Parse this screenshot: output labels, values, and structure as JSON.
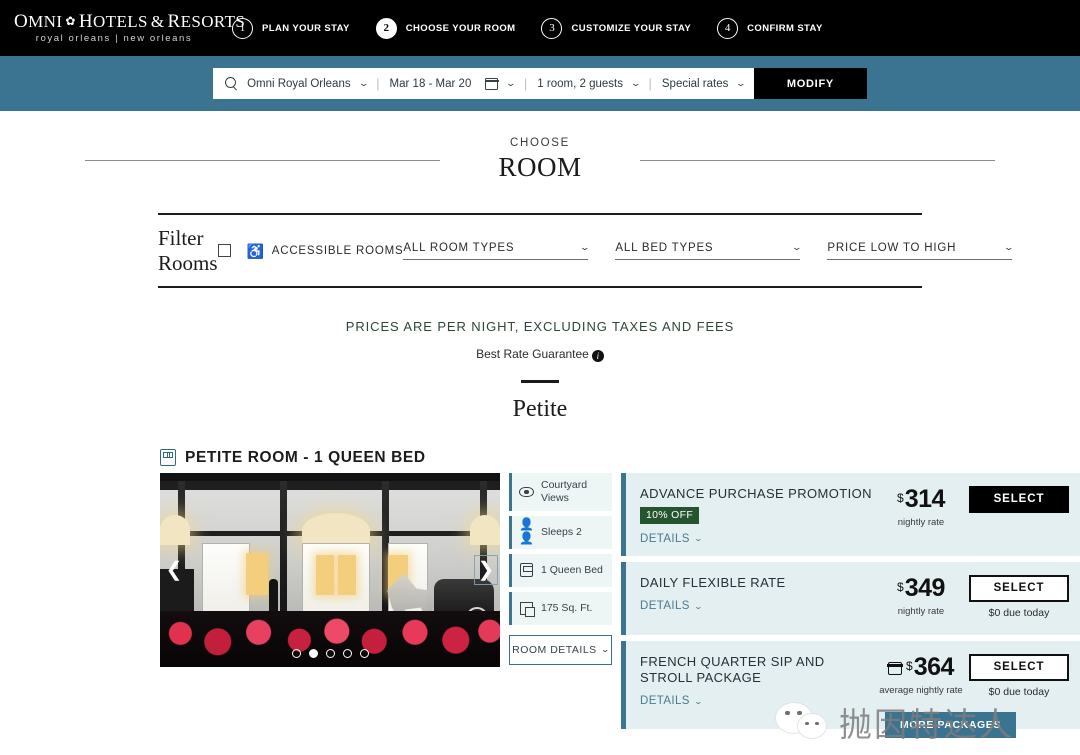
{
  "topnav": {
    "brand": {
      "line1_a": "O",
      "line1_b": "MNI",
      "line1_c": "H",
      "line1_d": "OTELS",
      "line1_e": "&",
      "line1_f": "R",
      "line1_g": "ESORTS",
      "flower": "✿",
      "sub": "royal orleans  |  new orleans"
    },
    "steps": [
      {
        "num": "1",
        "label": "PLAN YOUR STAY",
        "active": false
      },
      {
        "num": "2",
        "label": "CHOOSE YOUR ROOM",
        "active": true
      },
      {
        "num": "3",
        "label": "CUSTOMIZE YOUR STAY",
        "active": false
      },
      {
        "num": "4",
        "label": "CONFIRM STAY",
        "active": false
      }
    ]
  },
  "bookbar": {
    "property": "Omni Royal Orleans",
    "dates": "Mar 18 - Mar 20",
    "occupancy": "1 room, 2 guests",
    "rates": "Special rates",
    "modify_label": "MODIFY",
    "caret": "⌄",
    "separator": "|"
  },
  "page_head": {
    "kicker": "CHOOSE",
    "title": "ROOM"
  },
  "filter": {
    "title": "Filter Rooms",
    "accessible_label": "ACCESSIBLE ROOMS",
    "accessible_icon": "♿",
    "selects": [
      {
        "label": "ALL ROOM TYPES",
        "caret": "⌄"
      },
      {
        "label": "ALL BED TYPES",
        "caret": "⌄"
      },
      {
        "label": "PRICE LOW TO HIGH",
        "caret": "⌄"
      }
    ]
  },
  "notice": {
    "main": "PRICES ARE PER NIGHT, EXCLUDING TAXES AND FEES",
    "sub": "Best Rate Guarantee",
    "info_glyph": "i"
  },
  "category": {
    "title": "Petite"
  },
  "room": {
    "name": "PETITE ROOM - 1 QUEEN BED",
    "carousel": {
      "prev": "❮",
      "next": "❯",
      "dot_count": 5,
      "active_dot": 1
    },
    "amenities": [
      {
        "label": "Courtyard Views",
        "icon": "eye-icon"
      },
      {
        "label": "Sleeps 2",
        "icon": "people-icon",
        "glyph": "👤👤"
      },
      {
        "label": "1 Queen Bed",
        "icon": "bed-icon"
      },
      {
        "label": "175 Sq. Ft.",
        "icon": "square-feet-icon"
      }
    ],
    "room_details_label": "ROOM DETAILS",
    "room_details_caret": "⌄"
  },
  "rates": [
    {
      "name": "ADVANCE PURCHASE PROMOTION",
      "badge": "10% OFF",
      "details_label": "DETAILS",
      "caret": "⌄",
      "currency": "$",
      "price": "314",
      "price_sub": "nightly rate",
      "select_label": "SELECT",
      "due_today": "",
      "has_calendar_icon": false,
      "button_style": "solid"
    },
    {
      "name": "DAILY FLEXIBLE RATE",
      "badge": "",
      "details_label": "DETAILS",
      "caret": "⌄",
      "currency": "$",
      "price": "349",
      "price_sub": "nightly rate",
      "select_label": "SELECT",
      "due_today": "$0 due today",
      "has_calendar_icon": false,
      "button_style": "outline"
    },
    {
      "name": "FRENCH QUARTER SIP AND STROLL PACKAGE",
      "badge": "",
      "details_label": "DETAILS",
      "caret": "⌄",
      "currency": "$",
      "price": "364",
      "price_sub": "average nightly rate",
      "select_label": "SELECT",
      "due_today": "$0 due today",
      "has_calendar_icon": true,
      "button_style": "outline"
    }
  ],
  "more_packages_label": "MORE PACKAGES",
  "watermark": {
    "text": "抛因特达人"
  },
  "colors": {
    "nav_black": "#000000",
    "bookbar_teal": "#3b7490",
    "rate_card_bg": "#e3eff0",
    "rate_accent": "#3b7490",
    "badge_green": "#25552f",
    "notice_green": "#2e4636",
    "amenity_bg": "#eef5f5",
    "details_link": "#4a7b92"
  }
}
